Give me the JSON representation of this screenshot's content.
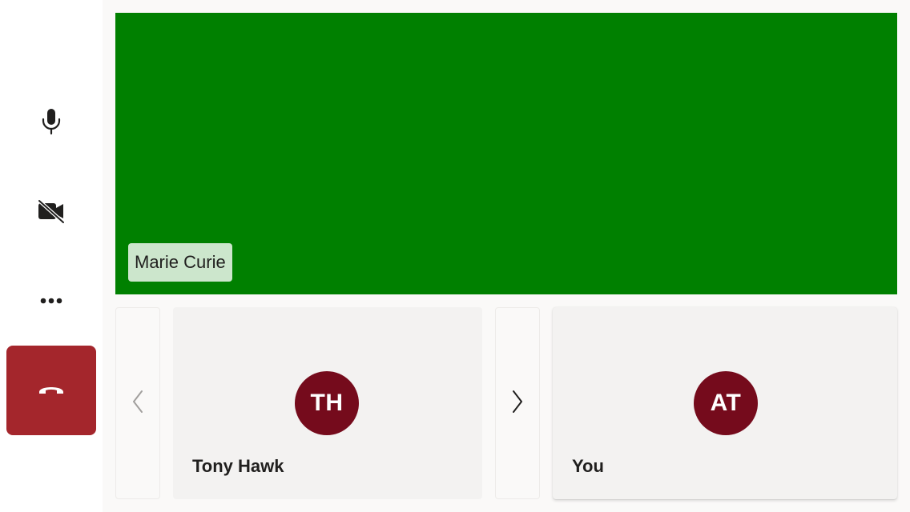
{
  "controls": {
    "microphone_icon": "microphone-icon",
    "camera_icon": "camera-off-icon",
    "more_icon": "more-options-icon",
    "hangup_icon": "hang-up-icon",
    "hangup_color": "#a4262c"
  },
  "main_video": {
    "participant_name": "Marie Curie",
    "background_color": "#008000"
  },
  "carousel": {
    "prev_icon": "chevron-left-icon",
    "next_icon": "chevron-right-icon",
    "participants": [
      {
        "initials": "TH",
        "name": "Tony Hawk",
        "avatar_color": "#750b1c"
      },
      {
        "initials": "AT",
        "name": "You",
        "avatar_color": "#750b1c"
      }
    ]
  }
}
